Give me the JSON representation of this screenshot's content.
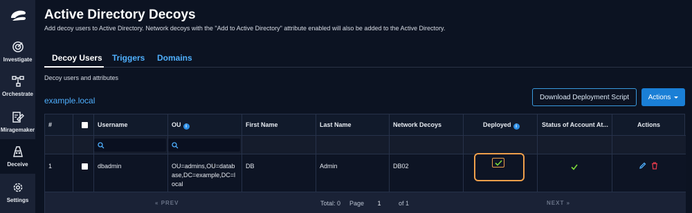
{
  "sidebar": {
    "logo_icon": "company-logo",
    "items": [
      {
        "label": "Investigate",
        "icon": "target-icon"
      },
      {
        "label": "Orchestrate",
        "icon": "orchestrate-icon"
      },
      {
        "label": "Miragemaker",
        "icon": "miragemaker-icon"
      },
      {
        "label": "Deceive",
        "icon": "deceive-icon"
      },
      {
        "label": "Settings",
        "icon": "gear-icon"
      }
    ],
    "active": "Deceive"
  },
  "page": {
    "title": "Active Directory Decoys",
    "description": "Add decoy users to Active Directory. Network decoys with the \"Add to Active Directory\" attribute enabled will also be added to the Active Directory."
  },
  "tabs": [
    {
      "label": "Decoy Users",
      "active": true
    },
    {
      "label": "Triggers",
      "active": false
    },
    {
      "label": "Domains",
      "active": false
    }
  ],
  "section": {
    "sublabel": "Decoy users and attributes",
    "domain": "example.local"
  },
  "buttons": {
    "download": "Download Deployment Script",
    "actions": "Actions"
  },
  "table": {
    "headers": {
      "num": "#",
      "username": "Username",
      "ou": "OU",
      "first_name": "First Name",
      "last_name": "Last Name",
      "network_decoys": "Network Decoys",
      "deployed": "Deployed",
      "status": "Status of Account At...",
      "actions": "Actions"
    },
    "rows": [
      {
        "num": "1",
        "username": "dbadmin",
        "ou": "OU=admins,OU=database,DC=example,DC=local",
        "ou_lines": [
          "OU=admins,OU=datab",
          "ase,DC=example,DC=l",
          "ocal"
        ],
        "first_name": "DB",
        "last_name": "Admin",
        "network_decoys": "DB02",
        "deployed": true,
        "status": true
      }
    ]
  },
  "pagination": {
    "prev": "PREV",
    "next": "NEXT",
    "total_label": "Total: 0",
    "page_label": "Page",
    "page_value": "1",
    "of_label": "of 1"
  },
  "colors": {
    "accent": "#4fb0ff",
    "primary_button": "#1a7fd6",
    "success": "#7ddc3a",
    "danger": "#e0394a",
    "highlight": "#f0a04b"
  }
}
